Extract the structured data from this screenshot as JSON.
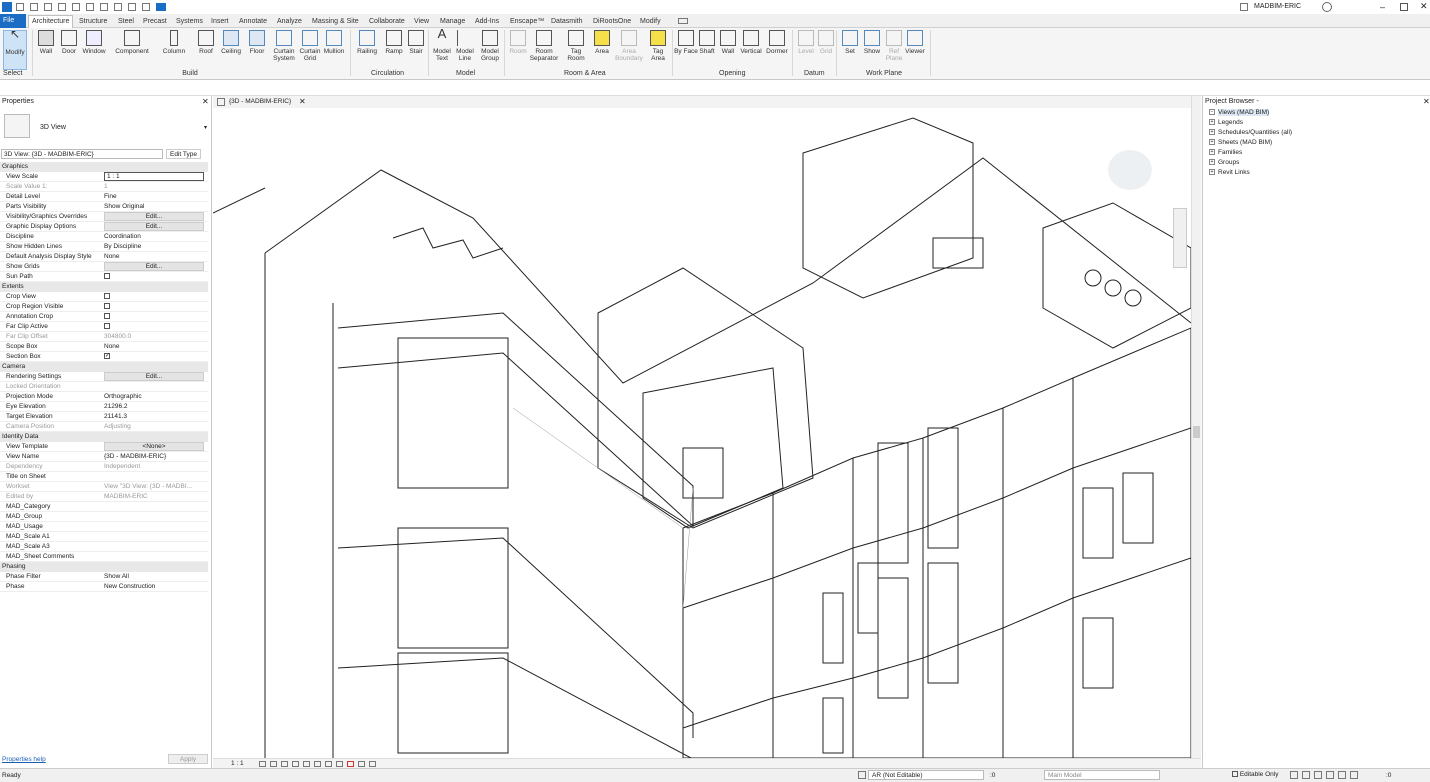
{
  "titlebar": {
    "user": "MADBIM-ERIC"
  },
  "menu": {
    "tabs": [
      "File",
      "Architecture",
      "Structure",
      "Steel",
      "Precast",
      "Systems",
      "Insert",
      "Annotate",
      "Analyze",
      "Massing & Site",
      "Collaborate",
      "View",
      "Manage",
      "Add-Ins",
      "Enscape™",
      "Datasmith",
      "DiRootsOne",
      "Modify"
    ],
    "active": "Architecture"
  },
  "ribbon": {
    "select": {
      "modify": "Modify",
      "select_label": "Select"
    },
    "build": {
      "label": "Build",
      "items": [
        "Wall",
        "Door",
        "Window",
        "Component",
        "Column",
        "Roof",
        "Ceiling",
        "Floor",
        "Curtain System",
        "Curtain Grid",
        "Mullion"
      ]
    },
    "circulation": {
      "label": "Circulation",
      "items": [
        "Railing",
        "Ramp",
        "Stair"
      ]
    },
    "model": {
      "label": "Model",
      "items": [
        "Model Text",
        "Model Line",
        "Model Group"
      ]
    },
    "room_area": {
      "label": "Room & Area",
      "items": [
        "Room",
        "Room Separator",
        "Tag Room",
        "Area",
        "Area Boundary",
        "Tag Area"
      ]
    },
    "opening": {
      "label": "Opening",
      "items": [
        "By Face",
        "Shaft",
        "Wall",
        "Vertical",
        "Dormer"
      ]
    },
    "datum": {
      "label": "Datum",
      "items": [
        "Level",
        "Grid"
      ]
    },
    "workplane": {
      "label": "Work Plane",
      "items": [
        "Set",
        "Show",
        "Ref Plane",
        "Viewer"
      ]
    }
  },
  "properties": {
    "title": "Properties",
    "type_name": "3D View",
    "selector": "3D View: {3D - MADBIM-ERIC}",
    "edit_type": "Edit Type",
    "help": "Properties help",
    "apply": "Apply",
    "groups": [
      {
        "name": "Graphics",
        "rows": [
          {
            "k": "View Scale",
            "v": "1 : 1",
            "grey": false,
            "input": true
          },
          {
            "k": "Scale Value    1:",
            "v": "1",
            "grey": true
          },
          {
            "k": "Detail Level",
            "v": "Fine"
          },
          {
            "k": "Parts Visibility",
            "v": "Show Original"
          },
          {
            "k": "Visibility/Graphics Overrides",
            "v": "Edit...",
            "btn": true
          },
          {
            "k": "Graphic Display Options",
            "v": "Edit...",
            "btn": true
          },
          {
            "k": "Discipline",
            "v": "Coordination"
          },
          {
            "k": "Show Hidden Lines",
            "v": "By Discipline"
          },
          {
            "k": "Default Analysis Display Style",
            "v": "None"
          },
          {
            "k": "Show Grids",
            "v": "Edit...",
            "btn": true
          },
          {
            "k": "Sun Path",
            "v": "",
            "cb": "off"
          }
        ]
      },
      {
        "name": "Extents",
        "rows": [
          {
            "k": "Crop View",
            "v": "",
            "cb": "off"
          },
          {
            "k": "Crop Region Visible",
            "v": "",
            "cb": "off"
          },
          {
            "k": "Annotation Crop",
            "v": "",
            "cb": "off"
          },
          {
            "k": "Far Clip Active",
            "v": "",
            "cb": "off"
          },
          {
            "k": "Far Clip Offset",
            "v": "304800.0",
            "grey": true
          },
          {
            "k": "Scope Box",
            "v": "None"
          },
          {
            "k": "Section Box",
            "v": "",
            "cb": "on"
          }
        ]
      },
      {
        "name": "Camera",
        "rows": [
          {
            "k": "Rendering Settings",
            "v": "Edit...",
            "btn": true
          },
          {
            "k": "Locked Orientation",
            "v": "",
            "grey": true
          },
          {
            "k": "Projection Mode",
            "v": "Orthographic"
          },
          {
            "k": "Eye Elevation",
            "v": "21296.2"
          },
          {
            "k": "Target Elevation",
            "v": "21141.3"
          },
          {
            "k": "Camera Position",
            "v": "Adjusting",
            "grey": true
          }
        ]
      },
      {
        "name": "Identity Data",
        "rows": [
          {
            "k": "View Template",
            "v": "<None>",
            "btn": true
          },
          {
            "k": "View Name",
            "v": "{3D - MADBIM-ERIC}"
          },
          {
            "k": "Dependency",
            "v": "Independent",
            "grey": true
          },
          {
            "k": "Title on Sheet",
            "v": ""
          },
          {
            "k": "Workset",
            "v": "View \"3D View: {3D - MADBI...",
            "grey": true
          },
          {
            "k": "Edited by",
            "v": "MADBIM-ERIC",
            "grey": true
          },
          {
            "k": "MAD_Category",
            "v": ""
          },
          {
            "k": "MAD_Group",
            "v": ""
          },
          {
            "k": "MAD_Usage",
            "v": ""
          },
          {
            "k": "MAD_Scale A1",
            "v": ""
          },
          {
            "k": "MAD_Scale A3",
            "v": ""
          },
          {
            "k": "MAD_Sheet Comments",
            "v": ""
          }
        ]
      },
      {
        "name": "Phasing",
        "rows": [
          {
            "k": "Phase Filter",
            "v": "Show All"
          },
          {
            "k": "Phase",
            "v": "New Construction"
          }
        ]
      }
    ]
  },
  "view": {
    "tab_title": "{3D - MADBIM-ERIC}",
    "scale": "1 : 1"
  },
  "browser": {
    "title": "Project Browser -",
    "items": [
      "Views (MAD BIM)",
      "Legends",
      "Schedules/Quantities (all)",
      "Sheets (MAD BIM)",
      "Families",
      "Groups",
      "Revit Links"
    ]
  },
  "status": {
    "left": "Ready",
    "workset": "AR (Not Editable)",
    "zero": ":0",
    "model": "Main Model",
    "editable": "Editable Only",
    "filter": ":0"
  },
  "colors": {
    "file_tab": "#1a6cc4",
    "accent": "#1a6cc4"
  }
}
